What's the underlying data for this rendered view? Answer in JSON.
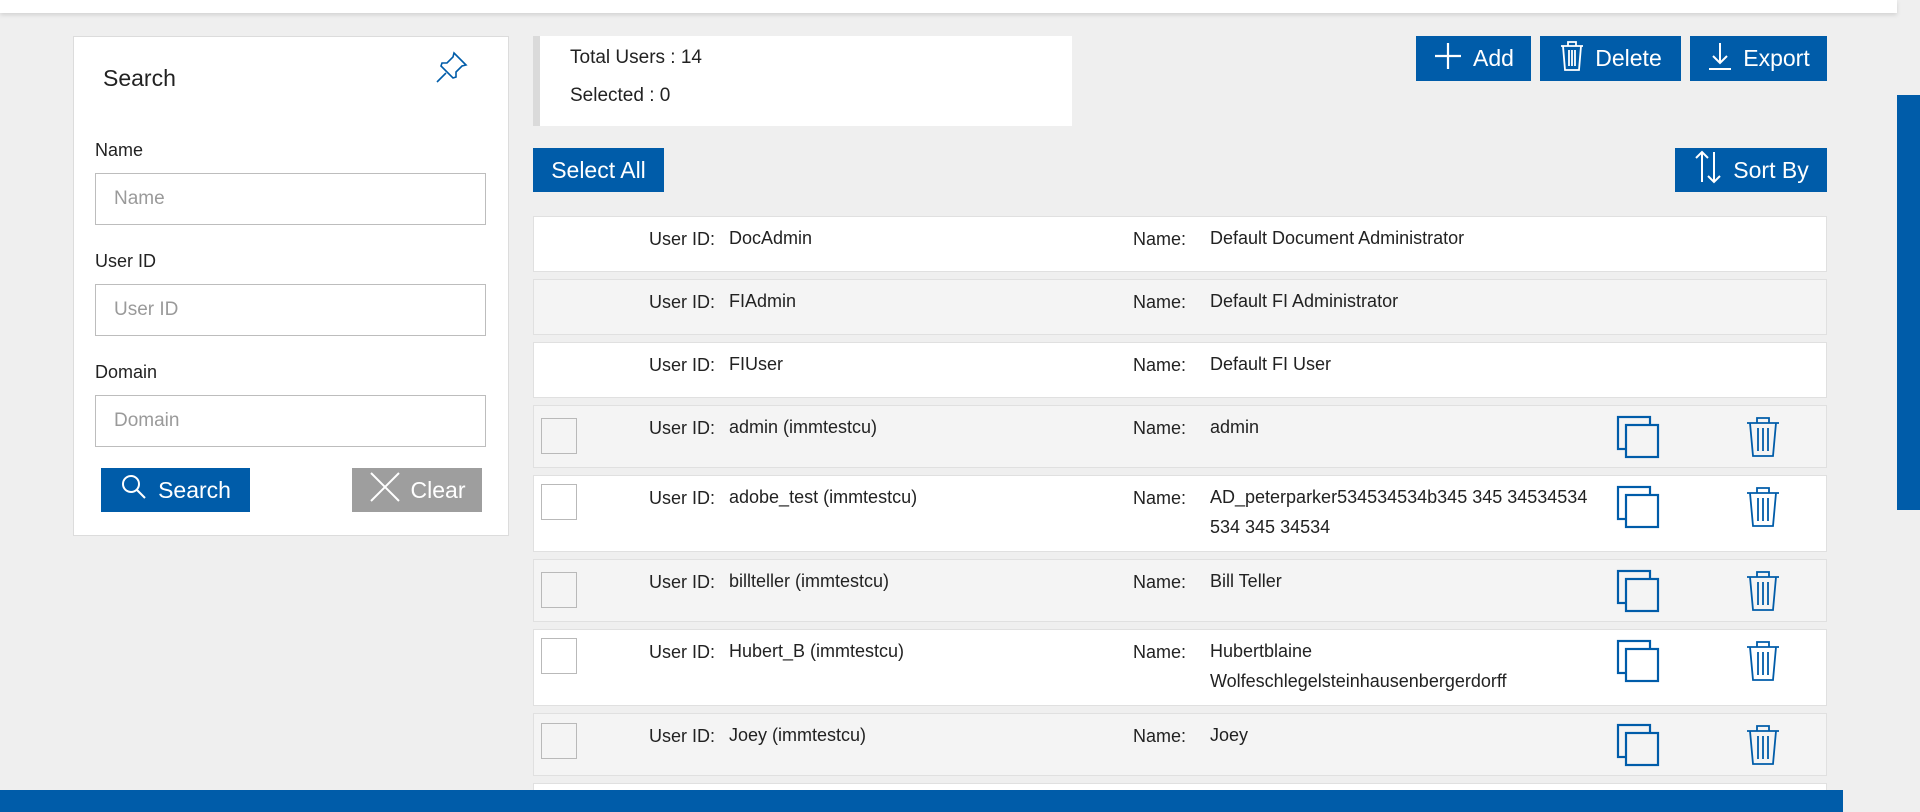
{
  "search": {
    "title": "Search",
    "name_label": "Name",
    "name_placeholder": "Name",
    "userid_label": "User ID",
    "userid_placeholder": "User ID",
    "domain_label": "Domain",
    "domain_placeholder": "Domain",
    "search_button": "Search",
    "clear_button": "Clear"
  },
  "stats": {
    "total_label": "Total Users : 14",
    "selected_label": "Selected : 0"
  },
  "toolbar": {
    "add": "Add",
    "delete": "Delete",
    "export": "Export",
    "select_all": "Select All",
    "sort_by": "Sort By"
  },
  "labels": {
    "user_id": "User ID:",
    "name": "Name:"
  },
  "users": [
    {
      "user_id": "DocAdmin",
      "name": "Default Document Administrator"
    },
    {
      "user_id": "FIAdmin",
      "name": "Default FI Administrator"
    },
    {
      "user_id": "FIUser",
      "name": "Default FI User"
    },
    {
      "user_id": "admin (immtestcu)",
      "name": "admin"
    },
    {
      "user_id": "adobe_test (immtestcu)",
      "name": "AD_peterparker534534534b345 345 34534534 534 345 34534"
    },
    {
      "user_id": "billteller (immtestcu)",
      "name": "Bill Teller"
    },
    {
      "user_id": "Hubert_B (immtestcu)",
      "name": "Hubertblaine Wolfeschlegelsteinhausenbergerdorff"
    },
    {
      "user_id": "Joey (immtestcu)",
      "name": "Joey"
    }
  ],
  "colors": {
    "primary": "#005ca9",
    "clear_button": "#9e9e9e"
  }
}
